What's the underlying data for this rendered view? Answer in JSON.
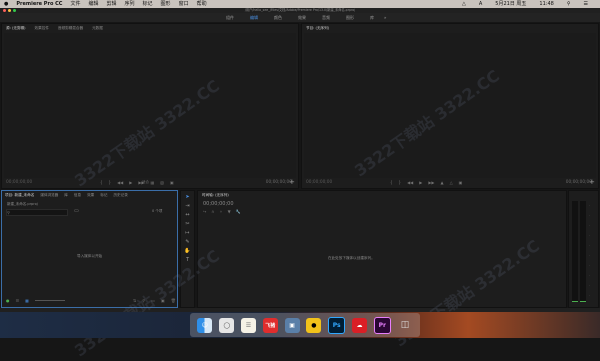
{
  "menubar": {
    "apple": "",
    "items": [
      "Premiere Pro CC",
      "文件",
      "编辑",
      "剪辑",
      "序列",
      "标记",
      "图形",
      "窗口",
      "帮助"
    ],
    "right": [
      "A",
      "5月21日 周五",
      "11:48"
    ]
  },
  "titlebar": {
    "path": "/用户/hello_see_/Files/文档/Adobe/Premiere Pro/13.0/新建_未命名.prproj"
  },
  "workspaces": {
    "items": [
      "组件",
      "编辑",
      "颜色",
      "效果",
      "音频",
      "图形",
      "库"
    ],
    "active_index": 1
  },
  "source_panel": {
    "tabs": [
      "源: (无剪辑)",
      "效果控件",
      "音频剪辑混合器",
      "元数据"
    ],
    "tc_left": "00;00;00;00",
    "tc_right": "00;00;00;00",
    "fit": "适合"
  },
  "program_panel": {
    "tabs": [
      "节目: (无序列)"
    ],
    "tc_left": "00;00;00;00",
    "tc_right": "00;00;00;00"
  },
  "project_panel": {
    "tabs": [
      "项目: 新建_未命名",
      "媒体浏览器",
      "库",
      "信息",
      "效果",
      "标记",
      "历史记录"
    ],
    "file": "新建_未命名.prproj",
    "item_count": "0 个项",
    "hint": "导入媒体以开始"
  },
  "timeline_panel": {
    "tabs": [
      "时间轴: (无序列)"
    ],
    "timecode": "00;00;00;00",
    "hint": "在此处放下媒体以创建序列。"
  },
  "watermark": "3322下载站  3322.CC",
  "colors": {
    "accent": "#4a90e2",
    "panel": "#1d1d1d",
    "bg": "#161616"
  },
  "dock": {
    "icons": [
      "finder-icon",
      "launchpad-icon",
      "notes-icon",
      "fliggy-icon",
      "photo-icon",
      "qq-icon",
      "photoshop-icon",
      "creative-cloud-icon",
      "premiere-icon",
      "trash-icon"
    ],
    "labels": {
      "fliggy": "飞猪",
      "ps": "Ps",
      "pr": "Pr"
    }
  }
}
